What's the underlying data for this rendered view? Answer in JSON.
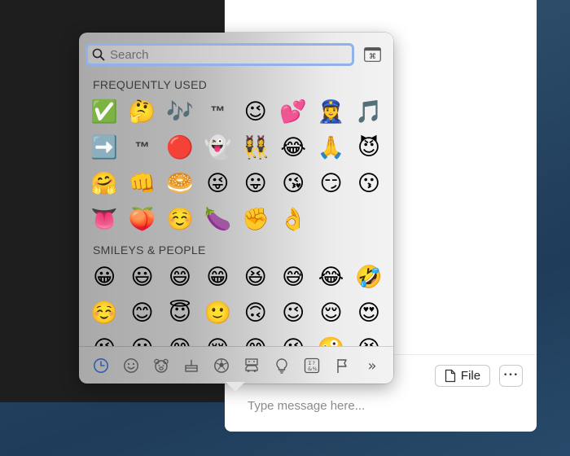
{
  "picker": {
    "search_placeholder": "Search",
    "section_frequent": "FREQUENTLY USED",
    "section_smileys": "SMILEYS & PEOPLE",
    "frequent": [
      "✅",
      "🤔",
      "🎶",
      "™",
      "😉",
      "💕",
      "👮‍♀️",
      "🎵",
      "➡️",
      "™",
      "🔴",
      "👻",
      "👯‍♀️",
      "😂",
      "🙏",
      "😈",
      "🤗",
      "👊",
      "🥯",
      "😜",
      "😛",
      "😘",
      "😏",
      "😗",
      "👅",
      "🍑",
      "☺️",
      "🍆",
      "✊",
      "👌"
    ],
    "smileys": [
      "😀",
      "😃",
      "😄",
      "😁",
      "😆",
      "😅",
      "😂",
      "🤣",
      "☺️",
      "😊",
      "😇",
      "🙂",
      "🙃",
      "😉",
      "😌",
      "😍",
      "😘",
      "😗",
      "😙",
      "😚",
      "😋",
      "😜",
      "🤪",
      "😝"
    ],
    "tabs": [
      {
        "name": "recent",
        "label": "Frequently Used"
      },
      {
        "name": "smileys",
        "label": "Smileys & People"
      },
      {
        "name": "animals",
        "label": "Animals & Nature"
      },
      {
        "name": "food",
        "label": "Food & Drink"
      },
      {
        "name": "activity",
        "label": "Activity"
      },
      {
        "name": "travel",
        "label": "Travel & Places"
      },
      {
        "name": "objects",
        "label": "Objects"
      },
      {
        "name": "symbols",
        "label": "Symbols"
      },
      {
        "name": "flags",
        "label": "Flags"
      },
      {
        "name": "more",
        "label": "»"
      }
    ],
    "accent_color": "#2f5fb3"
  },
  "compose": {
    "file_label": "File",
    "more_label": "•••",
    "message_placeholder": "Type message here..."
  }
}
